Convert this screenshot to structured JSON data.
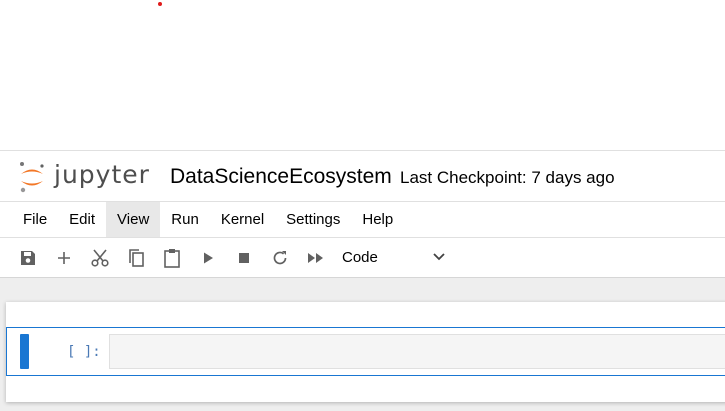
{
  "header": {
    "logo_word": "jupyter",
    "notebook_title": "DataScienceEcosystem",
    "checkpoint": "Last Checkpoint: 7 days ago"
  },
  "menu": {
    "items": [
      "File",
      "Edit",
      "View",
      "Run",
      "Kernel",
      "Settings",
      "Help"
    ],
    "active": "View"
  },
  "toolbar": {
    "icons": [
      "save-icon",
      "add-icon",
      "cut-icon",
      "copy-icon",
      "paste-icon",
      "run-icon",
      "stop-icon",
      "restart-icon",
      "fast-forward-icon"
    ],
    "cell_type": "Code"
  },
  "cell": {
    "prompt": "[ ]:",
    "source": ""
  },
  "colors": {
    "accent": "#1976d2",
    "logo_orange": "#f37726",
    "prompt": "#4a79b5"
  }
}
